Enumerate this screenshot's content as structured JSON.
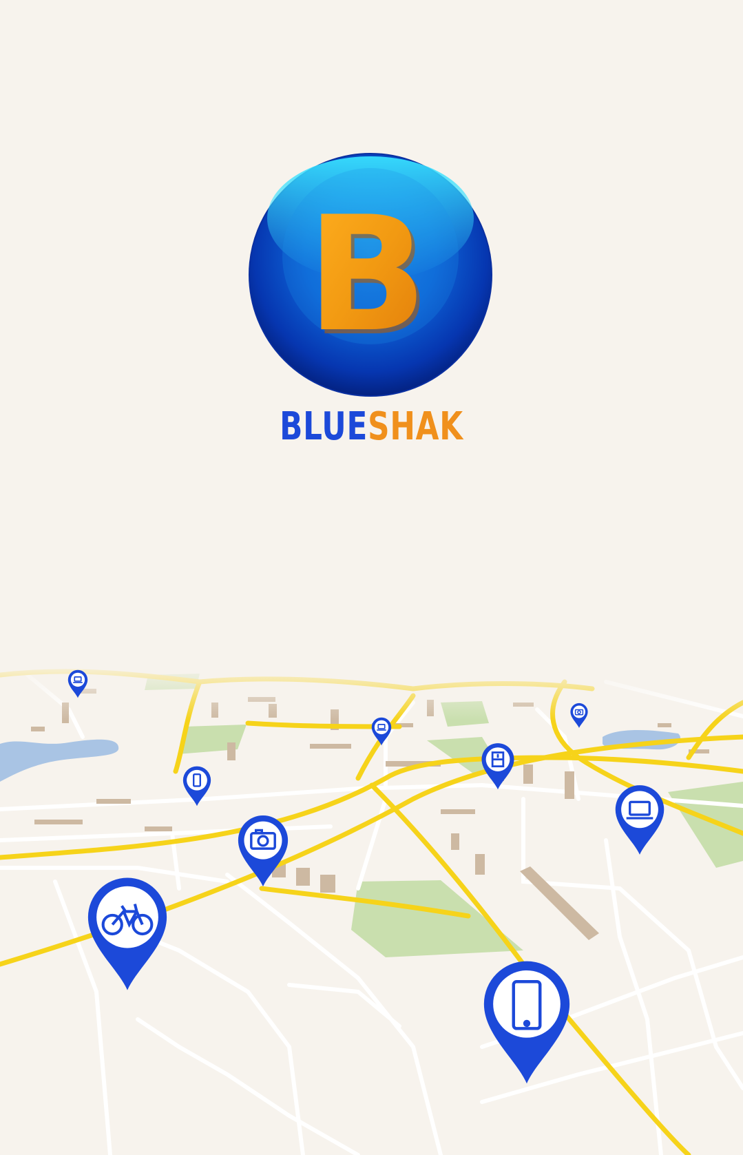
{
  "app": {
    "logo_letter": "B",
    "brand_part1": "BLUE",
    "brand_part2": "SHAK"
  },
  "colors": {
    "background": "#f7f3ed",
    "brand_blue": "#1c49d9",
    "brand_orange": "#f0901c",
    "road_major": "#f6d31a",
    "park": "#c9dfae",
    "water": "#a9c4e4",
    "building": "#cdb9a2"
  },
  "map": {
    "pins": [
      {
        "icon": "laptop-icon"
      },
      {
        "icon": "laptop-icon"
      },
      {
        "icon": "camera-icon"
      },
      {
        "icon": "smartphone-icon"
      },
      {
        "icon": "bookshelf-icon"
      },
      {
        "icon": "laptop-icon"
      },
      {
        "icon": "camera-icon"
      },
      {
        "icon": "bicycle-icon"
      },
      {
        "icon": "smartphone-icon"
      }
    ]
  }
}
